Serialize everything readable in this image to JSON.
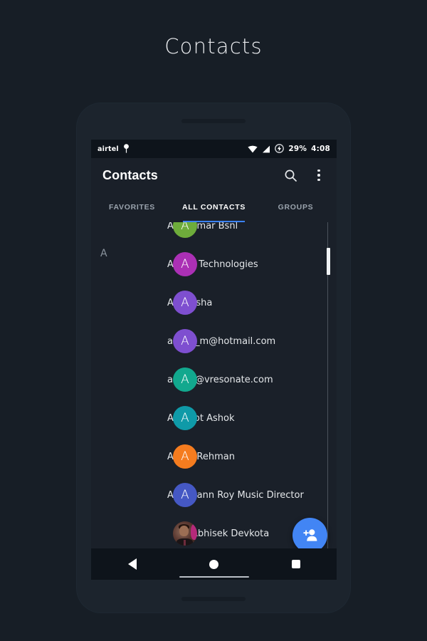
{
  "page": {
    "title": "Contacts",
    "background_color": "#171e26"
  },
  "phone": {
    "screen_background": "#1a2029"
  },
  "status_bar": {
    "carrier": "airtel",
    "battery_percent": "29%",
    "time": "4:08",
    "icons": [
      "location-icon",
      "wifi-icon",
      "signal-icon",
      "battery-charging-icon"
    ]
  },
  "app_bar": {
    "title": "Contacts",
    "search_icon": "search-icon",
    "overflow_icon": "overflow-menu-icon"
  },
  "tabs": {
    "active_index": 1,
    "indicator_color": "#3b82f6",
    "items": [
      {
        "label": "FAVORITES"
      },
      {
        "label": "ALL CONTACTS"
      },
      {
        "label": "GROUPS"
      }
    ]
  },
  "list": {
    "section_letter": "A",
    "contacts": [
      {
        "name": "A S Kumar Bsnl",
        "initial": "A",
        "color": "#6eac3b",
        "type": "initial"
      },
      {
        "name": "A-Kart Technologies",
        "initial": "A",
        "color": "#ab30b5",
        "type": "initial"
      },
      {
        "name": "Aakansha",
        "initial": "A",
        "color": "#7e4fd0",
        "type": "initial"
      },
      {
        "name": "aasim_m@hotmail.com",
        "initial": "A",
        "color": "#7e4fd0",
        "type": "initial"
      },
      {
        "name": "aasim@vresonate.com",
        "initial": "A",
        "color": "#12a88e",
        "type": "initial"
      },
      {
        "name": "Ab Infot Ashok",
        "initial": "A",
        "color": "#0f9aa8",
        "type": "initial"
      },
      {
        "name": "Abdul Rehman",
        "initial": "A",
        "color": "#f57c1f",
        "type": "initial"
      },
      {
        "name": "Abhimann Roy Music Director",
        "initial": "A",
        "color": "#4558c4",
        "type": "initial"
      },
      {
        "name": "Abhisek Devkota",
        "initial": "",
        "color": "#5c3a32",
        "type": "photo"
      }
    ]
  },
  "fab": {
    "icon": "add-contact-icon",
    "color": "#4285f4"
  },
  "nav_bar": {
    "back": "back-icon",
    "home": "home-icon",
    "recents": "recents-icon"
  }
}
